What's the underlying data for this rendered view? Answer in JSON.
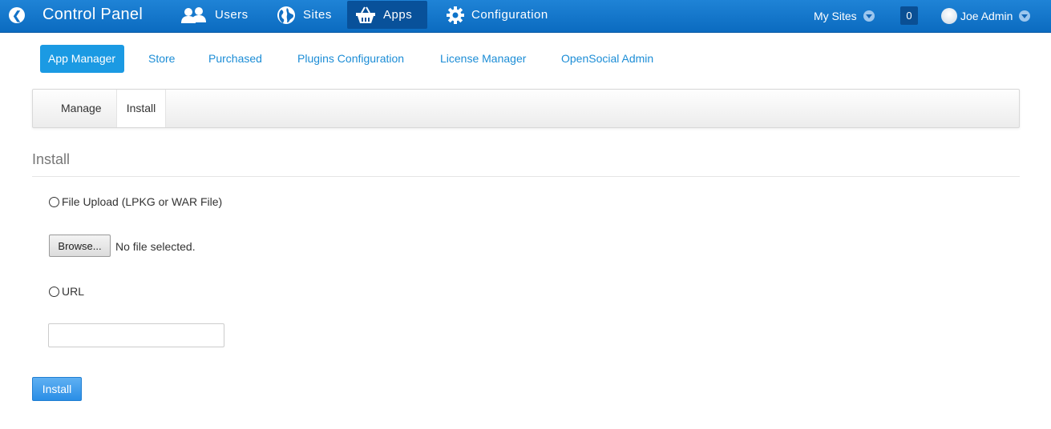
{
  "topbar": {
    "title": "Control Panel",
    "nav": [
      {
        "label": "Users",
        "icon": "users-icon"
      },
      {
        "label": "Sites",
        "icon": "globe-icon"
      },
      {
        "label": "Apps",
        "icon": "basket-icon",
        "active": true
      },
      {
        "label": "Configuration",
        "icon": "gear-icon"
      }
    ],
    "my_sites": "My Sites",
    "notification_count": "0",
    "user_name": "Joe Admin"
  },
  "subnav": {
    "items": [
      {
        "label": "App Manager",
        "active": true
      },
      {
        "label": "Store"
      },
      {
        "label": "Purchased"
      },
      {
        "label": "Plugins Configuration"
      },
      {
        "label": "License Manager"
      },
      {
        "label": "OpenSocial Admin"
      }
    ]
  },
  "tabs": [
    {
      "label": "Manage"
    },
    {
      "label": "Install",
      "active": true
    }
  ],
  "install_form": {
    "section_title": "Install",
    "file_upload_label": "File Upload (LPKG or WAR File)",
    "browse_label": "Browse...",
    "file_status": "No file selected.",
    "url_label": "URL",
    "url_value": "",
    "submit_label": "Install"
  },
  "colors": {
    "topbar": "#0f74c9",
    "link": "#1c8dd6",
    "active_pill": "#1b9ae3",
    "install_button": "#3a9ae8"
  }
}
